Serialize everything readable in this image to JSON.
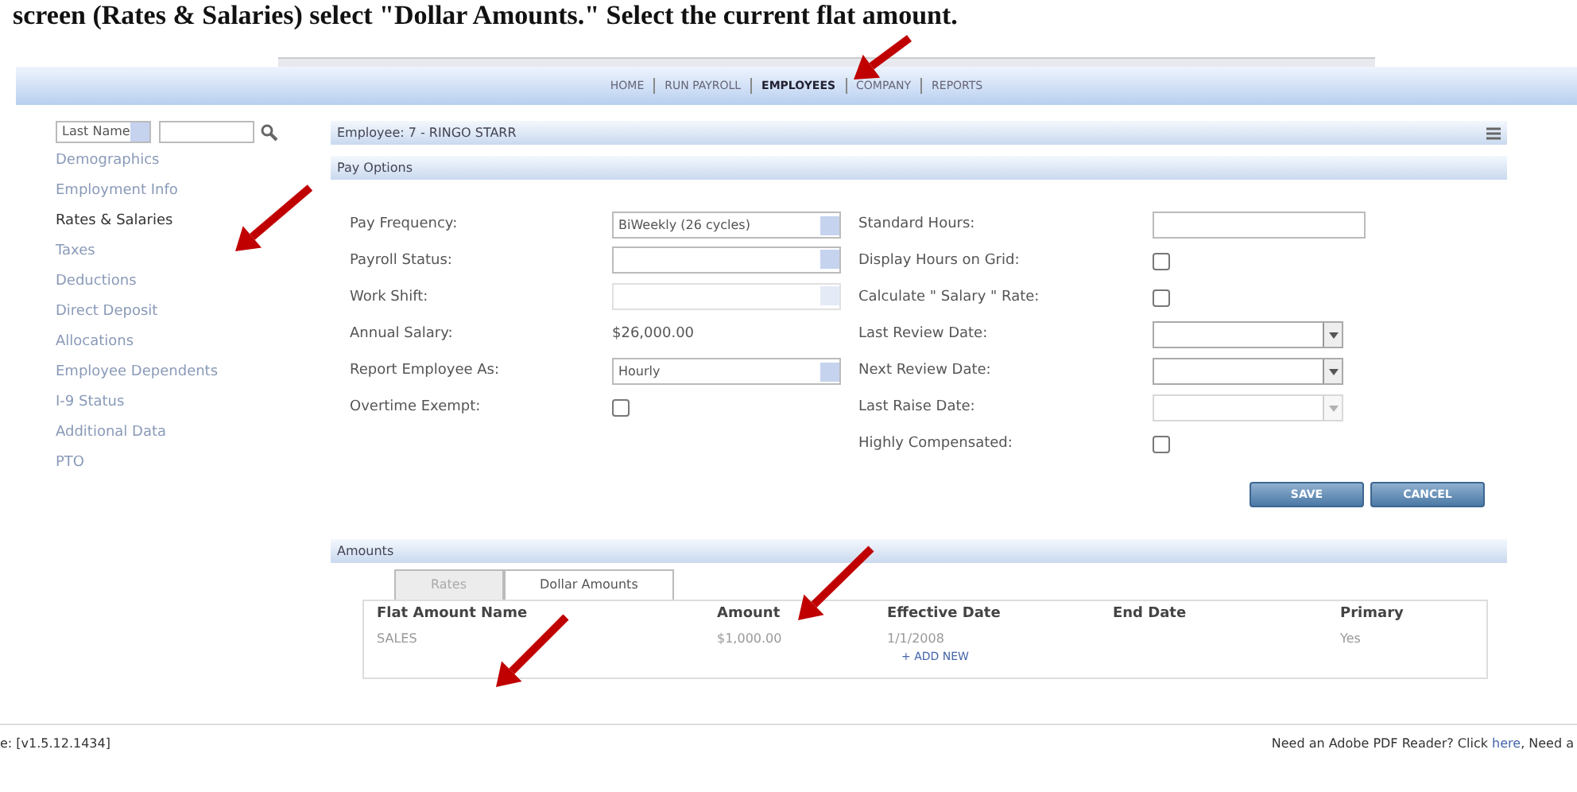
{
  "caption": "screen (Rates & Salaries) select \"Dollar Amounts.\" Select the current flat amount.",
  "nav": [
    {
      "label": "HOME",
      "selected": false
    },
    {
      "label": "RUN PAYROLL",
      "selected": false
    },
    {
      "label": "EMPLOYEES",
      "selected": true
    },
    {
      "label": "COMPANY",
      "selected": false
    },
    {
      "label": "REPORTS",
      "selected": false
    }
  ],
  "sidebar": {
    "filter": "Last Name",
    "items": [
      {
        "label": "Demographics",
        "selected": false
      },
      {
        "label": "Employment Info",
        "selected": false
      },
      {
        "label": "Rates & Salaries",
        "selected": true
      },
      {
        "label": "Taxes",
        "selected": false
      },
      {
        "label": "Deductions",
        "selected": false
      },
      {
        "label": "Direct Deposit",
        "selected": false
      },
      {
        "label": "Allocations",
        "selected": false
      },
      {
        "label": "Employee Dependents",
        "selected": false
      },
      {
        "label": "I-9 Status",
        "selected": false
      },
      {
        "label": "Additional Data",
        "selected": false
      },
      {
        "label": "PTO",
        "selected": false
      }
    ]
  },
  "header": {
    "title": "Employee: 7 - RINGO STARR"
  },
  "section": "Pay Options",
  "left_fields": [
    {
      "label": "Pay Frequency:",
      "kind": "select",
      "value": "BiWeekly (26 cycles)",
      "disabled": false
    },
    {
      "label": "Payroll Status:",
      "kind": "select",
      "disabled": false
    },
    {
      "label": "Work Shift:",
      "kind": "select",
      "disabled": true
    },
    {
      "label": "Annual Salary:",
      "kind": "text",
      "value": "$26,000.00"
    },
    {
      "label": "Report Employee As:",
      "kind": "select",
      "value": "Hourly",
      "disabled": false
    },
    {
      "label": "Overtime Exempt:",
      "kind": "checkbox",
      "checked": false
    }
  ],
  "right_fields": [
    {
      "label": "Standard Hours:",
      "kind": "input"
    },
    {
      "label": "Display Hours on Grid:",
      "kind": "checkbox",
      "checked": false
    },
    {
      "label": "Calculate \" Salary \" Rate:",
      "kind": "checkbox",
      "checked": false
    },
    {
      "label": "Last Review Date:",
      "kind": "date",
      "disabled": false
    },
    {
      "label": "Next Review Date:",
      "kind": "date",
      "disabled": false
    },
    {
      "label": "Last Raise Date:",
      "kind": "date",
      "disabled": true
    },
    {
      "label": "Highly Compensated:",
      "kind": "checkbox",
      "checked": false
    }
  ],
  "buttons": [
    "SAVE",
    "CANCEL"
  ],
  "amounts": {
    "title": "Amounts",
    "tabs": [
      {
        "label": "Rates",
        "selected": false
      },
      {
        "label": "Dollar Amounts",
        "selected": true
      }
    ],
    "columns": [
      "Flat Amount Name",
      "Amount",
      "Effective Date",
      "End Date",
      "Primary"
    ],
    "rows": [
      [
        "SALES",
        "$1,000.00",
        "1/1/2008",
        "",
        "Yes"
      ]
    ],
    "add_new": "+ ADD NEW"
  },
  "footer": {
    "version": "e: [v1.5.12.1434]",
    "text": "Need an Adobe PDF Reader? Click",
    "link": "here",
    "after": ", Need a"
  }
}
